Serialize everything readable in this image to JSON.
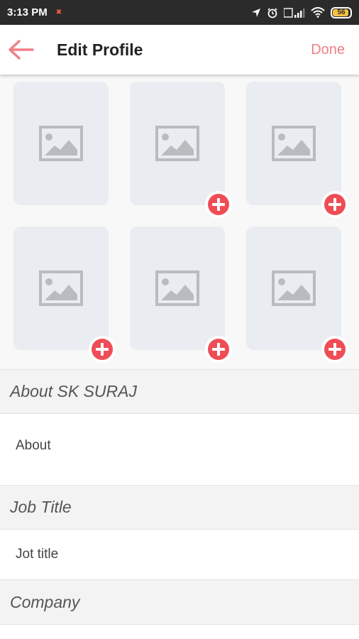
{
  "status_bar": {
    "time": "3:13 PM",
    "battery": "56"
  },
  "app_bar": {
    "title": "Edit Profile",
    "done_label": "Done"
  },
  "gallery": {
    "tiles": [
      {
        "has_add_button": false
      },
      {
        "has_add_button": true
      },
      {
        "has_add_button": true
      },
      {
        "has_add_button": true
      },
      {
        "has_add_button": true
      },
      {
        "has_add_button": true
      }
    ]
  },
  "sections": {
    "about_header": "About SK SURAJ",
    "about_placeholder": "About",
    "job_header": "Job Title",
    "job_placeholder": "Jot title",
    "company_header": "Company"
  },
  "colors": {
    "accent": "#f07f87",
    "add_button": "#ef4d56",
    "tile_bg": "#e9ecf0"
  },
  "icons": [
    "back-arrow-icon",
    "image-placeholder-icon",
    "add-circle-icon",
    "location-icon",
    "alarm-icon",
    "signal-icon",
    "wifi-icon",
    "battery-icon"
  ]
}
